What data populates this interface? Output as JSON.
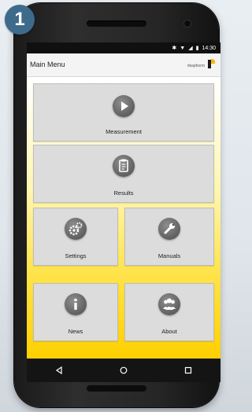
{
  "step_badge": "1",
  "status_bar": {
    "time": "14:30",
    "icons": [
      "bluetooth-icon",
      "wifi-icon",
      "signal-icon",
      "battery-icon"
    ]
  },
  "app_bar": {
    "title": "Main Menu",
    "brand": "rikaphorm"
  },
  "menu": {
    "measurement": {
      "label": "Measurement",
      "icon": "play-icon"
    },
    "results": {
      "label": "Results",
      "icon": "document-icon"
    },
    "settings": {
      "label": "Settings",
      "icon": "gears-icon"
    },
    "manuals": {
      "label": "Manuals",
      "icon": "wrench-icon"
    },
    "news": {
      "label": "News",
      "icon": "info-icon"
    },
    "about": {
      "label": "About",
      "icon": "people-icon"
    }
  },
  "nav": {
    "buttons": [
      "back-icon",
      "home-icon",
      "recents-icon"
    ]
  },
  "colors": {
    "accent": "#ffd400",
    "tile": "#dcdcdc",
    "badge": "#3e6a8c",
    "icon": "#5f5f5f"
  }
}
